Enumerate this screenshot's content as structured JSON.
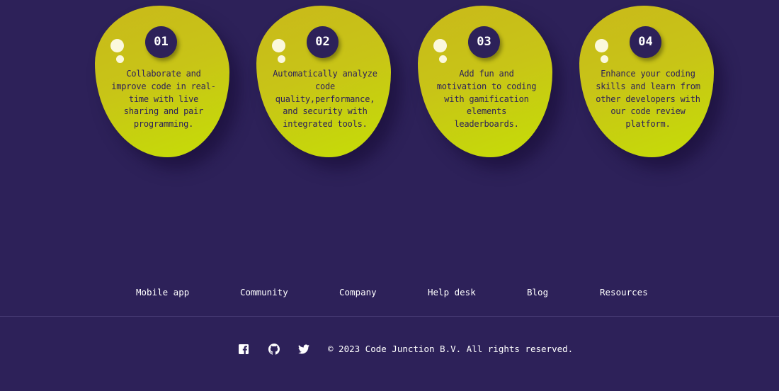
{
  "features": [
    {
      "number": "01",
      "text": "Collaborate and improve code in real-time with live sharing and pair programming."
    },
    {
      "number": "02",
      "text": "Automatically analyze code quality,performance, and security with integrated tools."
    },
    {
      "number": "03",
      "text": "Add fun and motivation to coding with gamification elements leaderboards."
    },
    {
      "number": "04",
      "text": "Enhance your coding skills and learn from other developers with our code review platform."
    }
  ],
  "footer": {
    "links": [
      "Mobile app",
      "Community",
      "Company",
      "Help desk",
      "Blog",
      "Resources"
    ],
    "social": [
      "facebook-icon",
      "github-icon",
      "twitter-icon"
    ],
    "copyright": "© 2023 Code Junction B.V. All rights reserved."
  },
  "colors": {
    "background": "#2d2159",
    "card": "#c9c616",
    "text_dark": "#2d2159",
    "text_light": "#ffffff"
  }
}
